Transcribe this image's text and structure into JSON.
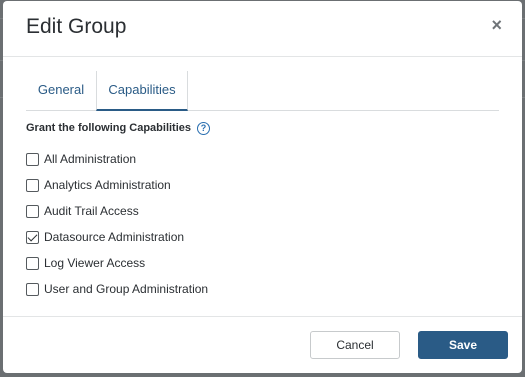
{
  "dialog": {
    "title": "Edit Group",
    "close_label": "×"
  },
  "tabs": [
    {
      "label": "General",
      "active": false
    },
    {
      "label": "Capabilities",
      "active": true
    }
  ],
  "capabilities": {
    "heading": "Grant the following Capabilities",
    "help_label": "?",
    "items": [
      {
        "label": "All Administration",
        "checked": false
      },
      {
        "label": "Analytics Administration",
        "checked": false
      },
      {
        "label": "Audit Trail Access",
        "checked": false
      },
      {
        "label": "Datasource Administration",
        "checked": true
      },
      {
        "label": "Log Viewer Access",
        "checked": false
      },
      {
        "label": "User and Group Administration",
        "checked": false
      }
    ]
  },
  "footer": {
    "cancel_label": "Cancel",
    "save_label": "Save"
  },
  "colors": {
    "accent": "#2a5b86",
    "backdrop": "#6b6f72"
  }
}
